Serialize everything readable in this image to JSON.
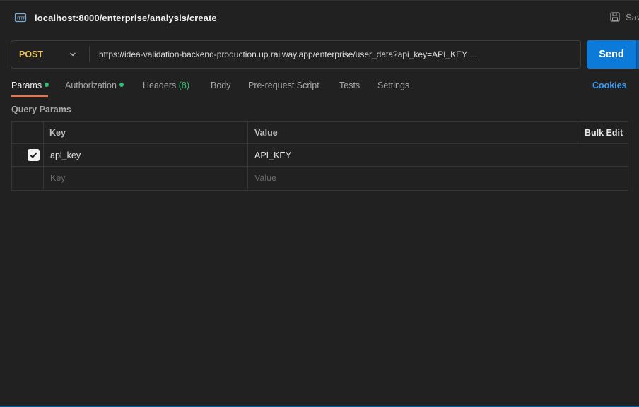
{
  "header": {
    "title": "localhost:8000/enterprise/analysis/create",
    "save_label": "Save",
    "icon": "http-icon"
  },
  "request": {
    "method": "POST",
    "url": "https://idea-validation-backend-production.up.railway.app/enterprise/user_data?api_key=API_KEY",
    "url_overflow": "...",
    "send_label": "Send"
  },
  "tabs": {
    "params": "Params",
    "authorization": "Authorization",
    "headers": "Headers",
    "headers_count": "(8)",
    "body": "Body",
    "prerequest": "Pre-request Script",
    "tests": "Tests",
    "settings": "Settings",
    "cookies": "Cookies"
  },
  "query_params": {
    "title": "Query Params",
    "columns": {
      "key": "Key",
      "value": "Value",
      "bulk_edit": "Bulk Edit"
    },
    "rows": [
      {
        "checked": true,
        "key": "api_key",
        "value": "API_KEY"
      }
    ],
    "placeholder": {
      "key": "Key",
      "value": "Value"
    }
  },
  "colors": {
    "accent": "#0b7ad8",
    "method": "#e8c55a",
    "active_tab": "#ff6c37",
    "status_dot": "#2fbf71",
    "link": "#3b9bf0"
  }
}
